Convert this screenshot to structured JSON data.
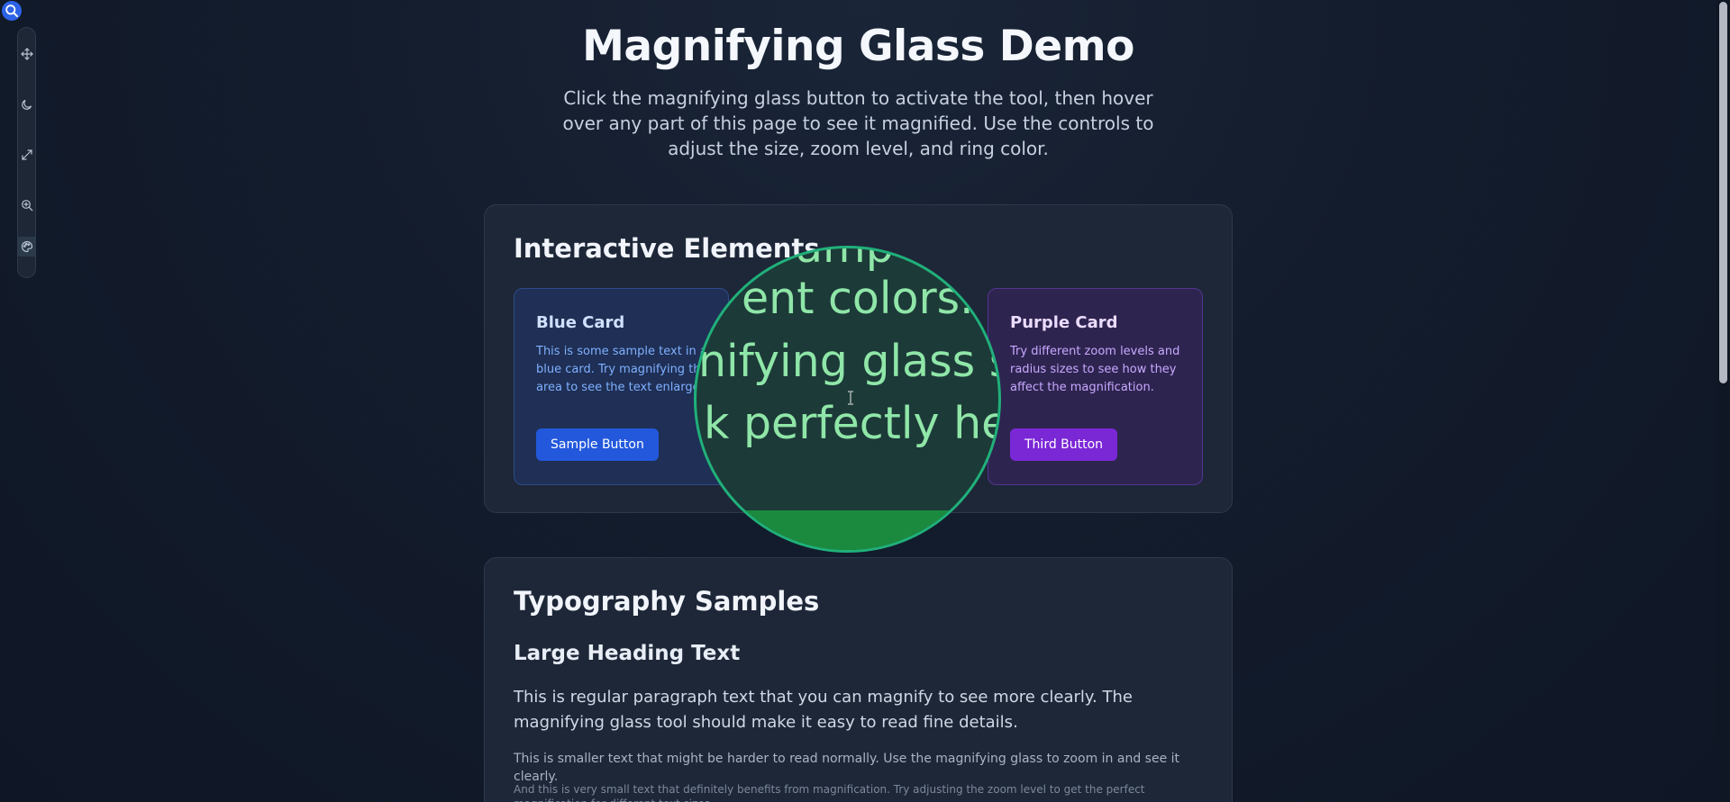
{
  "page": {
    "title": "Magnifying Glass Demo",
    "description": "Click the magnifying glass button to activate the tool, then hover over any part of this page to see it magnified. Use the controls to adjust the size, zoom level, and ring color."
  },
  "toolbar": {
    "items": [
      {
        "icon": "move-icon"
      },
      {
        "icon": "moon-icon"
      },
      {
        "icon": "expand-icon"
      },
      {
        "icon": "zoom-in-icon"
      },
      {
        "icon": "palette-icon"
      }
    ],
    "accent": "#2d63e6"
  },
  "interactive": {
    "title": "Interactive Elements",
    "blue_card": {
      "title": "Blue Card",
      "text": "This is some sample text in a blue card. Try magnifying this area to see the text enlarged.",
      "button": "Sample Button"
    },
    "purple_card": {
      "title": "Purple Card",
      "text": "Try different zoom levels and radius sizes to see how they affect the magnification.",
      "button": "Third Button"
    }
  },
  "magnifier": {
    "lines": [
      "amp",
      "ent colors.  T",
      "nifying glass s",
      "k perfectly her"
    ],
    "ring_color": "#20b07a"
  },
  "typography": {
    "title": "Typography Samples",
    "heading": "Large Heading Text",
    "paragraph": "This is regular paragraph text that you can magnify to see more clearly. The magnifying glass tool should make it easy to read fine details.",
    "small": "This is smaller text that might be harder to read normally. Use the magnifying glass to zoom in and see it clearly.",
    "tiny": "And this is very small text that definitely benefits from magnification. Try adjusting the zoom level to get the perfect magnification for different text sizes."
  }
}
